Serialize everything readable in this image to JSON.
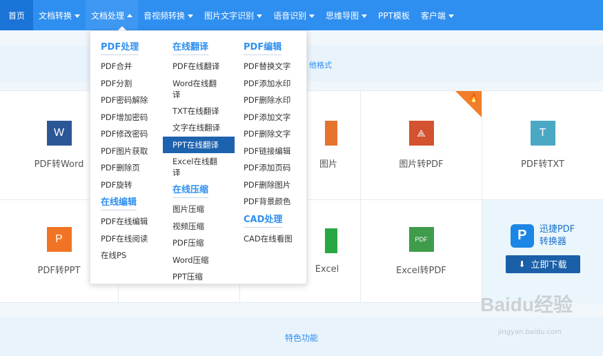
{
  "nav": {
    "items": [
      {
        "label": "首页",
        "caret": false
      },
      {
        "label": "文档转换",
        "caret": true
      },
      {
        "label": "文档处理",
        "caret": true
      },
      {
        "label": "音视频转换",
        "caret": true
      },
      {
        "label": "图片文字识别",
        "caret": true
      },
      {
        "label": "语音识别",
        "caret": true
      },
      {
        "label": "思维导图",
        "caret": true
      },
      {
        "label": "PPT模板",
        "caret": false
      },
      {
        "label": "客户端",
        "caret": true
      }
    ]
  },
  "band": {
    "hint": "他格式",
    "bottom_label": "特色功能"
  },
  "tools": [
    {
      "label": "PDF转Word",
      "glyph": "W",
      "color": "#2b5797"
    },
    {
      "label": "图片",
      "glyph": "",
      "color": "#e5742f"
    },
    {
      "label": "图片转PDF",
      "glyph": "⟁",
      "color": "#d35230"
    },
    {
      "label": "PDF转TXT",
      "glyph": "T",
      "color": "#4ba8c4"
    },
    {
      "label": "PDF转PPT",
      "glyph": "P",
      "color": "#f07423"
    },
    {
      "label": "Excel",
      "glyph": "",
      "color": "#27a844"
    },
    {
      "label": "Excel转PDF",
      "glyph": "PDF",
      "color": "#3f9c4a"
    }
  ],
  "promo": {
    "logo_letter": "P",
    "name_line1": "迅捷PDF",
    "name_line2": "转换器",
    "download_label": "立即下载"
  },
  "dropdown": {
    "col1": {
      "head": "PDF处理",
      "items": [
        "PDF合并",
        "PDF分割",
        "PDF密码解除",
        "PDF增加密码",
        "PDF修改密码",
        "PDF图片获取",
        "PDF删除页",
        "PDF旋转"
      ],
      "head2": "在线编辑",
      "items2": [
        "PDF在线编辑",
        "PDF在线阅读",
        "在线PS"
      ]
    },
    "col2": {
      "head": "在线翻译",
      "items": [
        "PDF在线翻译",
        "Word在线翻译",
        "TXT在线翻译",
        "文字在线翻译",
        "PPT在线翻译",
        "Excel在线翻译"
      ],
      "head2": "在线压缩",
      "items2": [
        "图片压缩",
        "视频压缩",
        "PDF压缩",
        "Word压缩",
        "PPT压缩"
      ]
    },
    "col3": {
      "head": "PDF编辑",
      "items": [
        "PDF替换文字",
        "PDF添加水印",
        "PDF删除水印",
        "PDF添加文字",
        "PDF删除文字",
        "PDF链接编辑",
        "PDF添加页码",
        "PDF删除图片",
        "PDF背景颜色"
      ],
      "head2": "CAD处理",
      "items2": [
        "CAD在线看图"
      ]
    }
  },
  "watermark": {
    "brand": "Baidu经验",
    "url": "jingyan.baidu.com"
  }
}
